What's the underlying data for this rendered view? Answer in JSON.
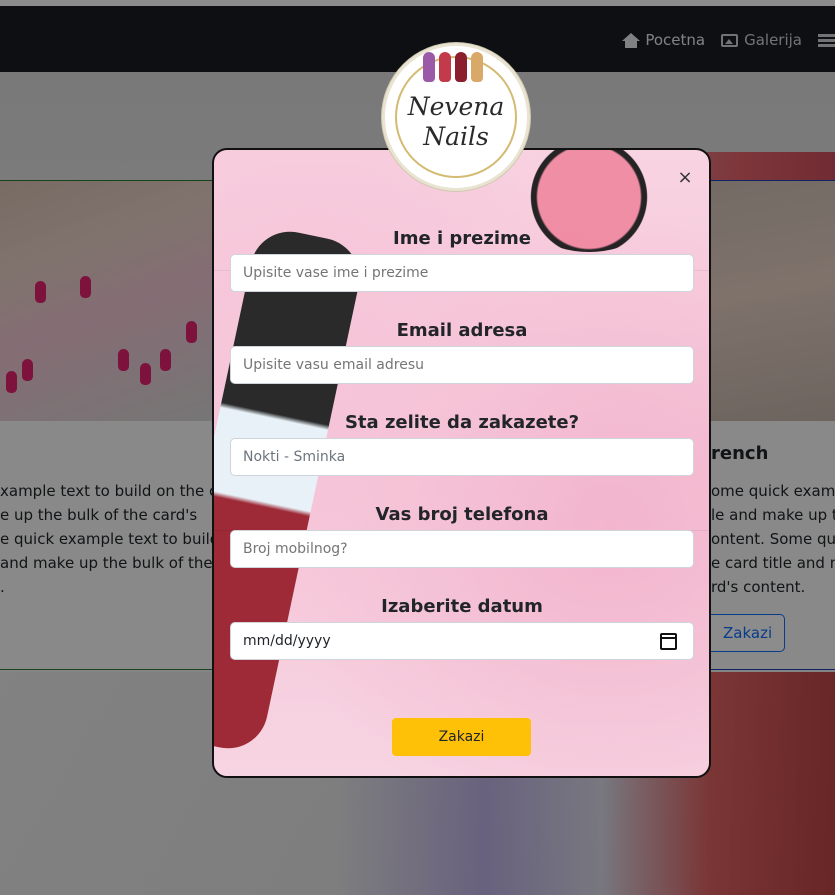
{
  "nav": {
    "items": [
      {
        "label": "Pocetna",
        "icon": "home-icon"
      },
      {
        "label": "Galerija",
        "icon": "image-icon"
      },
      {
        "label": "",
        "icon": "list-icon"
      }
    ]
  },
  "cards": {
    "left": {
      "text": "xample text to build on the card\ne up the bulk of the card's\ne quick example text to build on\nand make up the bulk of the\n."
    },
    "right": {
      "title": "rench",
      "text": "ome quick exampl\nle and make up th\nontent. Some quick\ne card title and m\nrd's content.",
      "button": "Zakazi"
    }
  },
  "logo": {
    "line1": "Nevena",
    "line2": "Nails"
  },
  "modal": {
    "close": "×",
    "fields": [
      {
        "label": "Ime i prezime",
        "placeholder": "Upisite vase ime i prezime",
        "value": ""
      },
      {
        "label": "Email adresa",
        "placeholder": "Upisite vasu email adresu",
        "value": ""
      },
      {
        "label": "Sta zelite da zakazete?",
        "placeholder": "",
        "value": "Nokti - Sminka"
      },
      {
        "label": "Vas broj telefona",
        "placeholder": "Broj mobilnog?",
        "value": ""
      },
      {
        "label": "Izaberite datum",
        "placeholder": "",
        "value": "mm/dd/yyyy"
      }
    ],
    "submit": "Zakazi"
  },
  "colors": {
    "navbar": "#1a1d22",
    "submit": "#ffc107",
    "card_button": "#0d6efd"
  }
}
